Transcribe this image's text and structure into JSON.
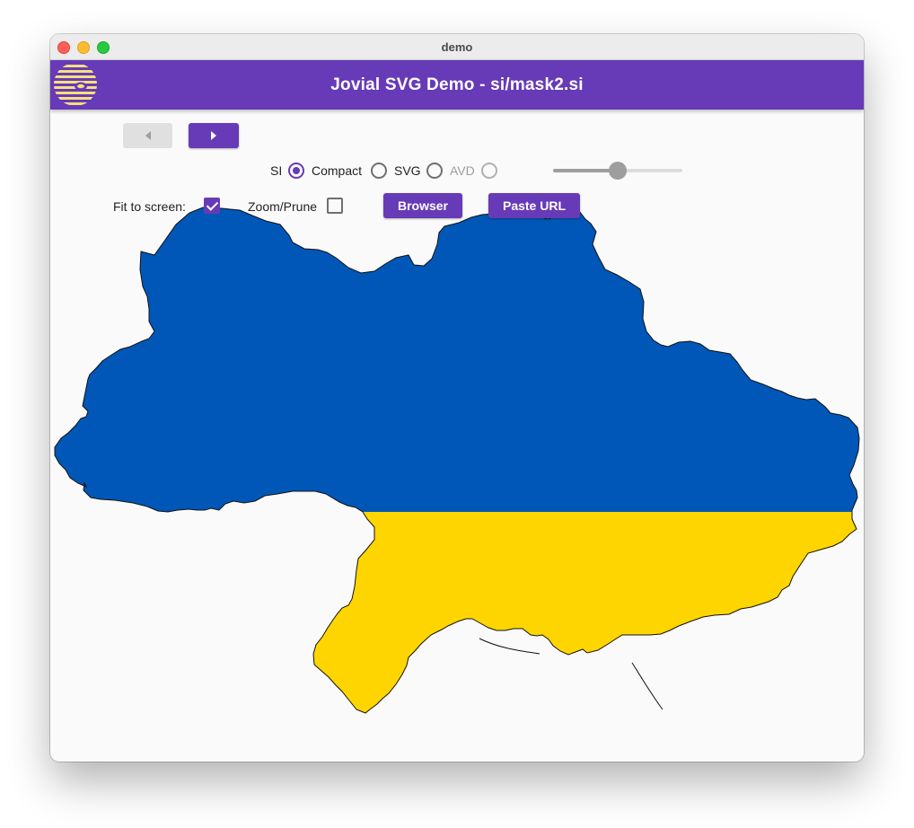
{
  "window": {
    "title": "demo"
  },
  "app_bar": {
    "title": "Jovial SVG Demo - si/mask2.si"
  },
  "toolbar": {
    "format_label": "SI",
    "radio_options": [
      {
        "label": "Compact",
        "selected": true,
        "disabled": false
      },
      {
        "label": "SVG",
        "selected": false,
        "disabled": false
      },
      {
        "label": "AVD",
        "selected": false,
        "disabled": true
      }
    ],
    "slider": {
      "value": 0.5
    },
    "fit_to_screen": {
      "label": "Fit to screen:",
      "checked": true
    },
    "zoom_prune": {
      "label": "Zoom/Prune",
      "checked": false
    },
    "browser_label": "Browser",
    "paste_url_label": "Paste URL"
  },
  "colors": {
    "accent": "#673ab7",
    "flag_blue": "#0057b7",
    "flag_yellow": "#ffd500",
    "logo_yellow": "#f7df7c"
  }
}
